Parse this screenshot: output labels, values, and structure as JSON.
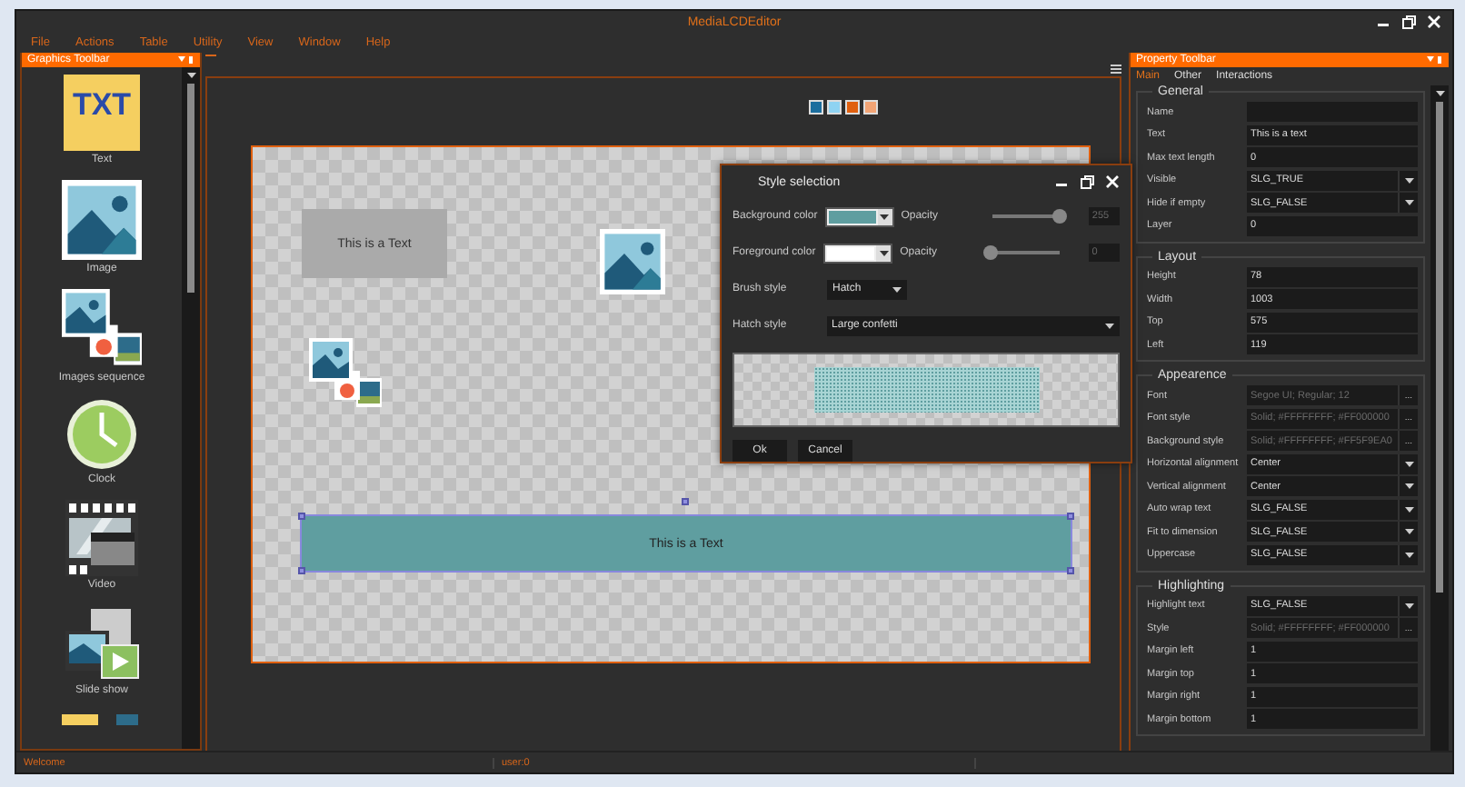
{
  "window": {
    "title": "MediaLCDEditor",
    "controls": [
      {
        "kind": "minimize"
      },
      {
        "kind": "restore"
      },
      {
        "kind": "close"
      }
    ]
  },
  "menu": [
    "File",
    "Actions",
    "Table",
    "Utility",
    "View",
    "Window",
    "Help"
  ],
  "graphics_toolbar": {
    "title": "Graphics Toolbar",
    "tools": [
      {
        "kind": "text",
        "label": "Text",
        "glyph": "TXT"
      },
      {
        "kind": "image",
        "label": "Image"
      },
      {
        "kind": "images",
        "label": "Images sequence"
      },
      {
        "kind": "clock",
        "label": "Clock"
      },
      {
        "kind": "video",
        "label": "Video"
      },
      {
        "kind": "slideshow",
        "label": "Slide show"
      },
      {
        "kind": "partial"
      }
    ]
  },
  "swatches": [
    {
      "color": "#1c6e9e"
    },
    {
      "color": "#8fd3f2"
    },
    {
      "color": "#e0600f"
    },
    {
      "color": "#f2a475"
    }
  ],
  "canvas": {
    "items": [
      {
        "kind": "label",
        "text": "This is a Text"
      },
      {
        "kind": "image"
      },
      {
        "kind": "images"
      },
      {
        "kind": "bar",
        "text": "This is a Text",
        "selected": true
      }
    ]
  },
  "style_dialog": {
    "title": "Style selection",
    "rows": [
      {
        "kind": "color",
        "label": "Background color",
        "color": "#5f9ea0",
        "opacity_label": "Opacity",
        "level": 1,
        "reading": "255"
      },
      {
        "kind": "color",
        "label": "Foreground color",
        "color": "#ffffff",
        "opacity_label": "Opacity",
        "level": 0,
        "reading": "0"
      },
      {
        "kind": "select",
        "label": "Brush style",
        "value": "Hatch"
      },
      {
        "kind": "combo",
        "label": "Hatch style",
        "value": "Large confetti"
      }
    ],
    "buttons": [
      "Ok",
      "Cancel"
    ]
  },
  "property_toolbar": {
    "title": "Property Toolbar",
    "tabs": [
      {
        "label": "Main",
        "selected": true
      },
      {
        "label": "Other",
        "selected": false
      },
      {
        "label": "Interactions",
        "selected": false
      }
    ],
    "groups": [
      {
        "title": "General",
        "rows": [
          {
            "kind": "text",
            "label": "Name"
          },
          {
            "kind": "text",
            "label": "Text",
            "value": "This is a text"
          },
          {
            "kind": "text",
            "label": "Max text length",
            "value": "0"
          },
          {
            "kind": "select",
            "label": "Visible",
            "value": "SLG_TRUE"
          },
          {
            "kind": "select",
            "label": "Hide if empty",
            "value": "SLG_FALSE"
          },
          {
            "kind": "text",
            "label": "Layer",
            "value": "0"
          }
        ]
      },
      {
        "title": "Layout",
        "rows": [
          {
            "kind": "text",
            "label": "Height",
            "value": "78"
          },
          {
            "kind": "text",
            "label": "Width",
            "value": "1003"
          },
          {
            "kind": "text",
            "label": "Top",
            "value": "575"
          },
          {
            "kind": "text",
            "label": "Left",
            "value": "119"
          }
        ]
      },
      {
        "title": "Appearence",
        "rows": [
          {
            "kind": "button",
            "label": "Font",
            "value": "Segoe UI; Regular; 12",
            "button": "...",
            "disabled": true
          },
          {
            "kind": "button",
            "label": "Font style",
            "value": "Solid; #FFFFFFFF; #FF000000",
            "button": "...",
            "disabled": true
          },
          {
            "kind": "button",
            "label": "Background style",
            "value": "Solid; #FFFFFFFF; #FF5F9EA0",
            "button": "...",
            "disabled": true
          },
          {
            "kind": "select",
            "label": "Horizontal alignment",
            "value": "Center"
          },
          {
            "kind": "select",
            "label": "Vertical alignment",
            "value": "Center"
          },
          {
            "kind": "select",
            "label": "Auto wrap text",
            "value": "SLG_FALSE"
          },
          {
            "kind": "select",
            "label": "Fit to dimension",
            "value": "SLG_FALSE"
          },
          {
            "kind": "select",
            "label": "Uppercase",
            "value": "SLG_FALSE"
          }
        ]
      },
      {
        "title": "Highlighting",
        "rows": [
          {
            "kind": "select",
            "label": "Highlight text",
            "value": "SLG_FALSE"
          },
          {
            "kind": "button",
            "label": "Style",
            "value": "Solid; #FFFFFFFF; #FF000000",
            "button": "...",
            "disabled": true
          },
          {
            "kind": "text",
            "label": "Margin left",
            "value": "1"
          },
          {
            "kind": "text",
            "label": "Margin top",
            "value": "1"
          },
          {
            "kind": "text",
            "label": "Margin right",
            "value": "1"
          },
          {
            "kind": "text",
            "label": "Margin bottom",
            "value": "1"
          }
        ]
      }
    ]
  },
  "status_bar": [
    "Welcome",
    "user:0"
  ]
}
